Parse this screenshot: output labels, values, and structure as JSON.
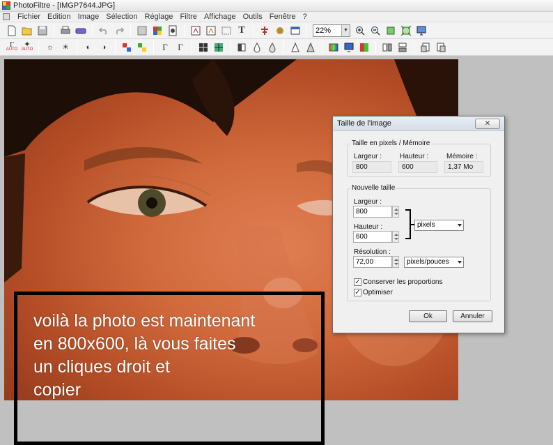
{
  "window": {
    "title": "PhotoFiltre - [IMGP7644.JPG]"
  },
  "menu": {
    "items": [
      "Fichier",
      "Edition",
      "Image",
      "Sélection",
      "Réglage",
      "Filtre",
      "Affichage",
      "Outils",
      "Fenêtre",
      "?"
    ]
  },
  "toolbar1": {
    "zoom": "22%",
    "text_tool_glyph": "T"
  },
  "toolbar2": {
    "auto_levels_label": "AUTO",
    "auto_contrast_label": "AUTO"
  },
  "canvas": {
    "overlay_text_lines": [
      "voilà la photo est maintenant",
      "en 800x600, là vous faites",
      "un cliques droit et",
      "copier"
    ]
  },
  "dialog": {
    "title": "Taille de l'image",
    "close_glyph": "✕",
    "current_size": {
      "label": "Taille en pixels / Mémoire",
      "width_label": "Largeur :",
      "width_value": "800",
      "height_label": "Hauteur :",
      "height_value": "600",
      "memory_label": "Mémoire :",
      "memory_value": "1,37 Mo"
    },
    "new_size": {
      "label": "Nouvelle taille",
      "width_label": "Largeur :",
      "width_value": "800",
      "height_label": "Hauteur :",
      "height_value": "600",
      "unit_selected": "pixels",
      "resolution_label": "Résolution :",
      "resolution_value": "72,00",
      "resolution_unit_selected": "pixels/pouces",
      "keep_proportions_label": "Conserver les proportions",
      "keep_proportions_checked": true,
      "optimize_label": "Optimiser",
      "optimize_checked": true
    },
    "ok_label": "Ok",
    "cancel_label": "Annuler"
  }
}
